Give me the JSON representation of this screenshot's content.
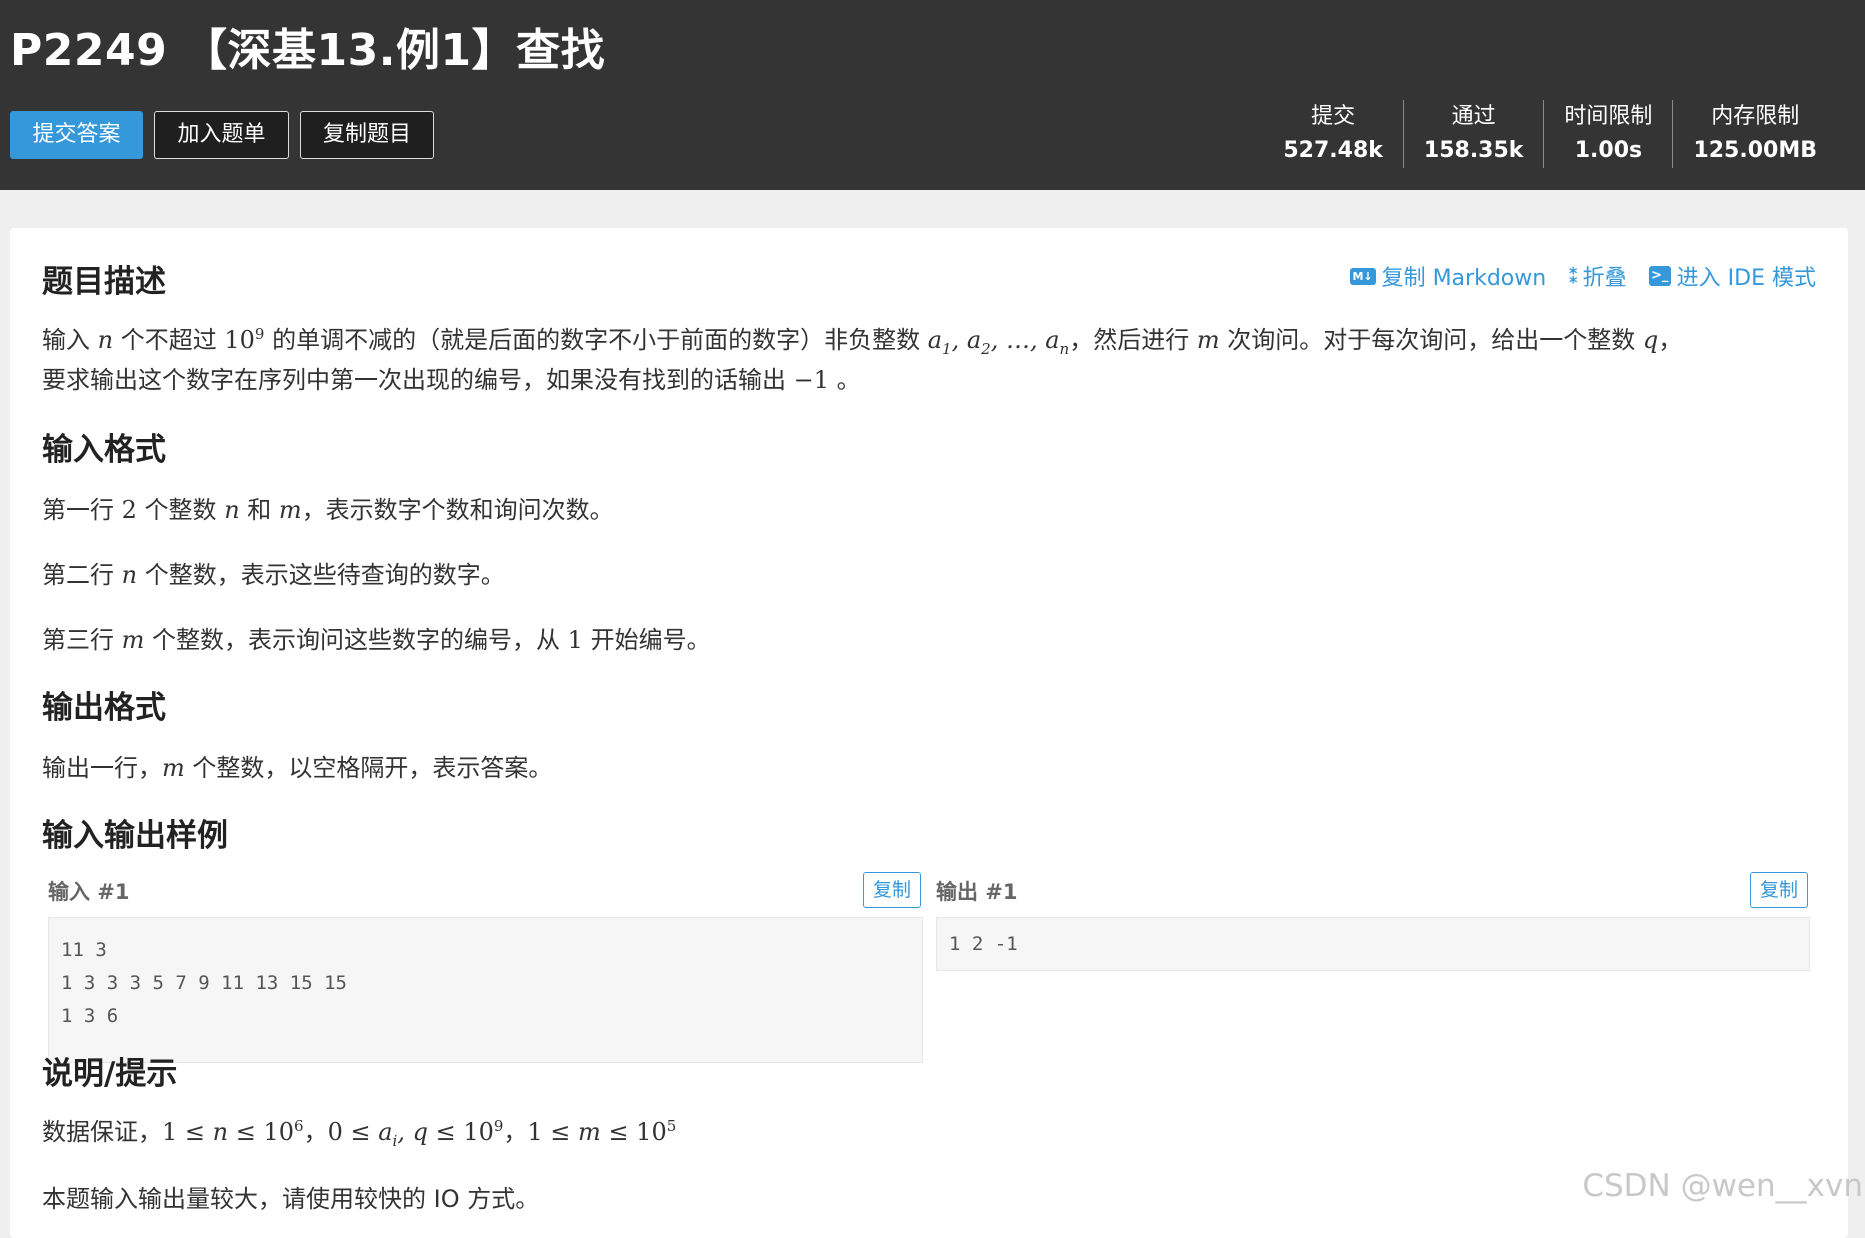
{
  "header": {
    "title": "P2249 【深基13.例1】查找",
    "buttons": {
      "submit": "提交答案",
      "add_list": "加入题单",
      "copy_problem": "复制题目"
    },
    "stats": [
      {
        "label": "提交",
        "value": "527.48k"
      },
      {
        "label": "通过",
        "value": "158.35k"
      },
      {
        "label": "时间限制",
        "value": "1.00s"
      },
      {
        "label": "内存限制",
        "value": "125.00MB"
      }
    ]
  },
  "toolbar": {
    "copy_markdown": "复制 Markdown",
    "fold": "折叠",
    "ide_mode": "进入 IDE 模式",
    "icons": [
      "markdown-icon",
      "fold-icon",
      "terminal-icon"
    ]
  },
  "description": {
    "heading": "题目描述"
  },
  "input_format": {
    "heading": "输入格式"
  },
  "output_format": {
    "heading": "输出格式"
  },
  "samples": {
    "heading": "输入输出样例",
    "input_label": "输入 #1",
    "output_label": "输出 #1",
    "copy_label": "复制",
    "input": "11 3\n1 3 3 3 5 7 9 11 13 15 15\n1 3 6",
    "output": "1 2 -1"
  },
  "hint": {
    "heading": "说明/提示",
    "io_note": "本题输入输出量较大，请使用较快的 IO 方式。"
  },
  "watermark": "CSDN @wen__xvn",
  "colors": {
    "header_bg": "#343434",
    "accent": "#3498db",
    "page_bg": "#efefef"
  }
}
